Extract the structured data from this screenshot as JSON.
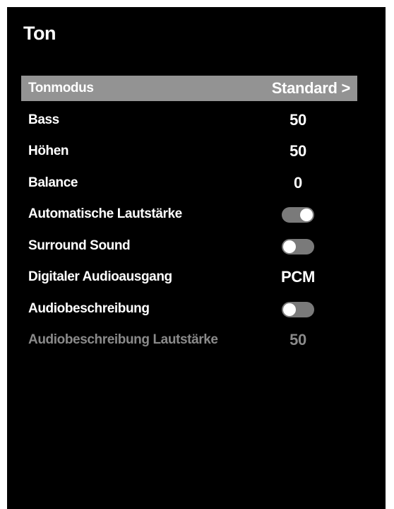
{
  "menu": {
    "title": "Ton",
    "items": [
      {
        "label": "Tonmodus",
        "value": "Standard >",
        "type": "submenu",
        "selected": true
      },
      {
        "label": "Bass",
        "value": "50",
        "type": "value"
      },
      {
        "label": "Höhen",
        "value": "50",
        "type": "value"
      },
      {
        "label": "Balance",
        "value": "0",
        "type": "value"
      },
      {
        "label": "Automatische Lautstärke",
        "type": "toggle",
        "state": "on"
      },
      {
        "label": "Surround Sound",
        "type": "toggle",
        "state": "off"
      },
      {
        "label": "Digitaler Audioausgang",
        "value": "PCM",
        "type": "value"
      },
      {
        "label": "Audiobeschreibung",
        "type": "toggle",
        "state": "off"
      },
      {
        "label": "Audiobeschreibung Lautstärke",
        "value": "50",
        "type": "value",
        "disabled": true
      }
    ]
  },
  "colors": {
    "background": "#000000",
    "highlight": "#939393",
    "text": "#ffffff",
    "disabled_text": "#8a8a8a",
    "toggle_track": "#7a7a7a"
  }
}
